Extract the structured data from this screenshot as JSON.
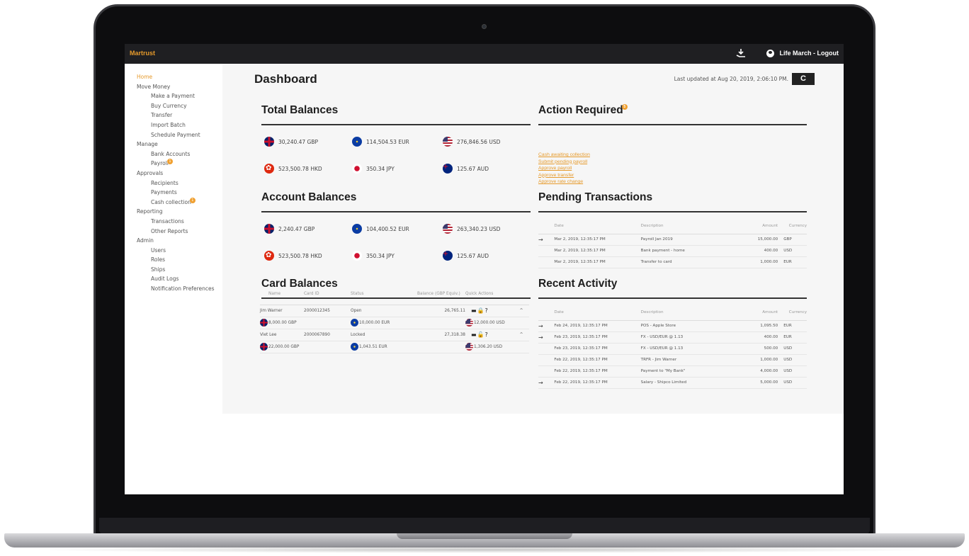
{
  "app": {
    "brand": "Martrust",
    "download_icon": "download-icon",
    "user_icon": "user-icon",
    "user_label": "Life March - Logout"
  },
  "sidebar": {
    "items": [
      {
        "label": "Home",
        "level": 0,
        "active": true
      },
      {
        "label": "Move Money",
        "level": 0
      },
      {
        "label": "Make a Payment",
        "level": 1
      },
      {
        "label": "Buy Currency",
        "level": 1
      },
      {
        "label": "Transfer",
        "level": 1
      },
      {
        "label": "Import Batch",
        "level": 1
      },
      {
        "label": "Schedule Payment",
        "level": 1
      },
      {
        "label": "Manage",
        "level": 0
      },
      {
        "label": "Bank Accounts",
        "level": 1
      },
      {
        "label": "Payroll",
        "level": 1,
        "badge": "1"
      },
      {
        "label": "Approvals",
        "level": 0
      },
      {
        "label": "Recipients",
        "level": 1
      },
      {
        "label": "Payments",
        "level": 1
      },
      {
        "label": "Cash collection",
        "level": 1,
        "badge": "1"
      },
      {
        "label": "Reporting",
        "level": 0
      },
      {
        "label": "Transactions",
        "level": 1
      },
      {
        "label": "Other Reports",
        "level": 1
      },
      {
        "label": "Admin",
        "level": 0
      },
      {
        "label": "Users",
        "level": 1
      },
      {
        "label": "Roles",
        "level": 1
      },
      {
        "label": "Ships",
        "level": 1
      },
      {
        "label": "Audit Logs",
        "level": 1
      },
      {
        "label": "Notification Preferences",
        "level": 1
      }
    ]
  },
  "header": {
    "title": "Dashboard",
    "last_updated": "Last updated at Aug 20, 2019, 2:06:10 PM.",
    "refresh_icon": "refresh-icon",
    "refresh_glyph": "C"
  },
  "total_balances": {
    "title": "Total Balances",
    "rows": [
      [
        {
          "flag": "gbp",
          "text": "30,240.47 GBP"
        },
        {
          "flag": "eur",
          "text": "114,504.53 EUR"
        },
        {
          "flag": "usd",
          "text": "276,846.56 USD"
        }
      ],
      [
        {
          "flag": "hkd",
          "text": "523,500.78 HKD"
        },
        {
          "flag": "jpy",
          "text": "350.34 JPY"
        },
        {
          "flag": "aud",
          "text": "125.67 AUD"
        }
      ]
    ]
  },
  "account_balances": {
    "title": "Account Balances",
    "rows": [
      [
        {
          "flag": "gbp",
          "text": "2,240.47 GBP"
        },
        {
          "flag": "eur",
          "text": "104,400.52 EUR"
        },
        {
          "flag": "usd",
          "text": "263,340.23 USD"
        }
      ],
      [
        {
          "flag": "hkd",
          "text": "523,500.78 HKD"
        },
        {
          "flag": "jpy",
          "text": "350.34 JPY"
        },
        {
          "flag": "aud",
          "text": "125.67 AUD"
        }
      ]
    ]
  },
  "card_balances": {
    "title": "Card Balances",
    "columns": [
      "Name",
      "Card ID",
      "Status",
      "Balance (GBP Equiv.)",
      "Quick Actions"
    ],
    "cards": [
      {
        "name": "Jim Warner",
        "card_id": "2000012345",
        "status": "Open",
        "balance": "26,765.11",
        "actions": "▬🔒?",
        "expand": "^",
        "sub": [
          {
            "flag": "gbp",
            "text": "8,000.00 GBP"
          },
          {
            "flag": "eur",
            "text": "10,000.00 EUR"
          },
          {
            "flag": "usd",
            "text": "12,000.00 USD"
          }
        ]
      },
      {
        "name": "Viet Lee",
        "card_id": "2000067890",
        "status": "Locked",
        "balance": "27,318.38",
        "actions": "▬🔓?",
        "expand": "^",
        "sub": [
          {
            "flag": "gbp",
            "text": "22,000.00 GBP"
          },
          {
            "flag": "eur",
            "text": "1,043.51 EUR"
          },
          {
            "flag": "usd",
            "text": "1,306.20 USD"
          }
        ]
      }
    ]
  },
  "action_required": {
    "title": "Action Required",
    "badge": "5",
    "links": [
      "Cash awaiting collection",
      "Submit pending payroll",
      "Approve payroll",
      "Approve transfer",
      "Approve rate change"
    ]
  },
  "pending_transactions": {
    "title": "Pending Transactions",
    "columns": [
      "Date",
      "Description",
      "Amount",
      "Currency"
    ],
    "rows": [
      {
        "arrow": "→",
        "date": "Mar 2, 2019, 12:35:17 PM",
        "desc": "Payroll Jan 2019",
        "amount": "15,000.00",
        "currency": "GBP"
      },
      {
        "arrow": "",
        "date": "Mar 2, 2019, 12:35:17 PM",
        "desc": "Bank payment - home",
        "amount": "400.00",
        "currency": "USD"
      },
      {
        "arrow": "",
        "date": "Mar 2, 2019, 12:35:17 PM",
        "desc": "Transfer to card",
        "amount": "1,000.00",
        "currency": "EUR"
      }
    ]
  },
  "recent_activity": {
    "title": "Recent Activity",
    "columns": [
      "Date",
      "Description",
      "Amount",
      "Currency"
    ],
    "rows": [
      {
        "arrow": "→",
        "date": "Feb 24, 2019, 12:35:17 PM",
        "desc": "POS - Apple Store",
        "amount": "1,095.50",
        "currency": "EUR"
      },
      {
        "arrow": "→",
        "date": "Feb 23, 2019, 12:35:17 PM",
        "desc": "FX - USD/EUR @ 1.13",
        "amount": "400.00",
        "currency": "EUR"
      },
      {
        "arrow": "",
        "date": "Feb 23, 2019, 12:35:17 PM",
        "desc": "FX - USD/EUR @ 1.13",
        "amount": "500.00",
        "currency": "USD"
      },
      {
        "arrow": "",
        "date": "Feb 22, 2019, 12:35:17 PM",
        "desc": "TRFR - Jim Warner",
        "amount": "1,000.00",
        "currency": "USD"
      },
      {
        "arrow": "",
        "date": "Feb 22, 2019, 12:35:17 PM",
        "desc": "Payment to \"My Bank\"",
        "amount": "4,000.00",
        "currency": "USD"
      },
      {
        "arrow": "→",
        "date": "Feb 22, 2019, 12:35:17 PM",
        "desc": "Salary - Shipco Limited",
        "amount": "5,000.00",
        "currency": "USD"
      }
    ]
  }
}
